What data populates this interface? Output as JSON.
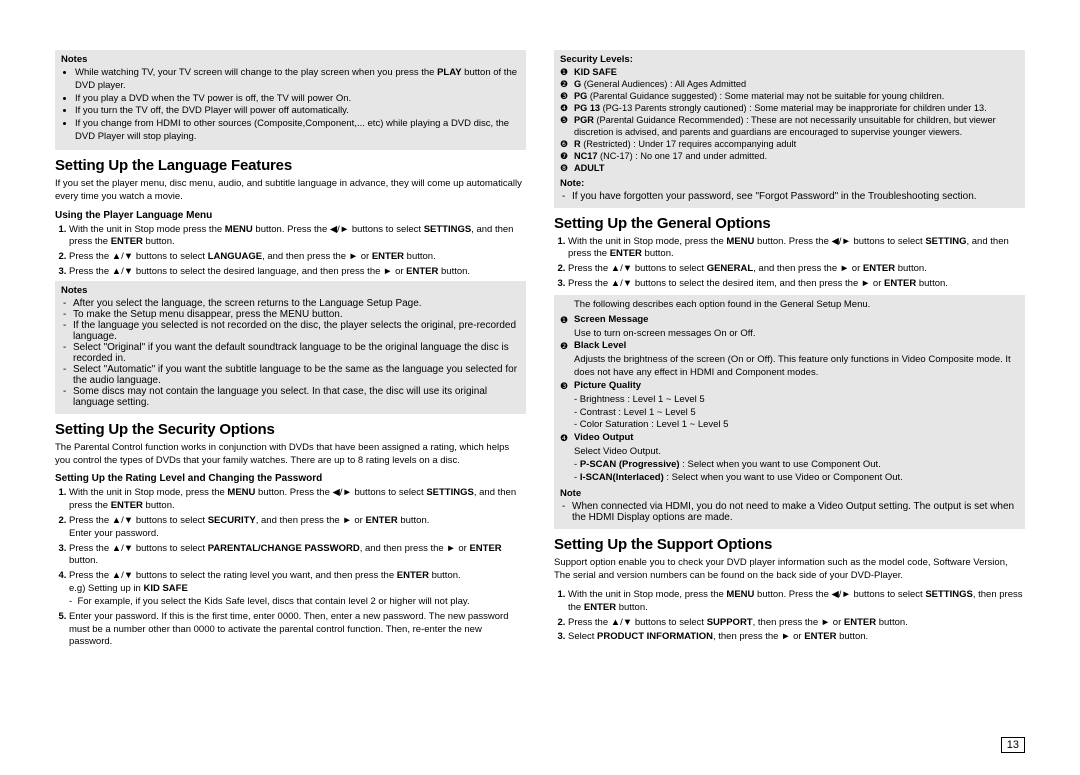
{
  "left": {
    "notes1": {
      "title": "Notes",
      "items": [
        "While watching TV, your TV screen will change to the play screen when you press the <b>PLAY</b> button of the DVD player.",
        "If you play a DVD when the TV power is off, the TV will power On.",
        "If you turn the TV off, the DVD Player will power off automatically.",
        "If you change from HDMI to other sources (Composite,Component,... etc) while playing a DVD disc, the DVD Player will stop playing."
      ]
    },
    "lang": {
      "heading": "Setting Up the Language Features",
      "lead": "If you set the player menu, disc menu, audio, and subtitle language in advance, they will come up automatically every time you watch a movie.",
      "sub1": "Using the Player Language Menu",
      "steps": [
        "With the unit in Stop mode press the <b>MENU</b> button. Press the ◀/► buttons to select <b>SETTINGS</b>, and then press the <b>ENTER</b> button.",
        "Press the ▲/▼ buttons to select <b>LANGUAGE</b>, and then press the ► or <b>ENTER</b> button.",
        "Press the ▲/▼ buttons to select the desired language, and then press the ► or <b>ENTER</b> button."
      ],
      "notes": {
        "title": "Notes",
        "items": [
          "After you select the language, the screen returns to the Language Setup Page.",
          "To make the Setup menu disappear, press the MENU button.",
          "If the language you selected is not recorded on the disc, the player selects the original, pre-recorded language.",
          "Select \"Original\" if you want the default soundtrack language to be the original language the disc is recorded in.",
          "Select \"Automatic\" if you want the subtitle language to be the same as the language you selected for the audio language.",
          "Some discs may not contain the language you select. In that case, the disc will use its original language setting."
        ]
      }
    },
    "sec": {
      "heading": "Setting Up the Security Options",
      "lead": "The Parental Control function works in conjunction with DVDs that have been assigned a rating, which helps you control the types of DVDs that your family watches. There are up to 8 rating levels on a disc.",
      "sub1": "Setting Up the Rating Level and Changing the Password",
      "steps": [
        "With the unit in Stop mode, press the <b>MENU</b> button. Press the ◀/► buttons to select <b>SETTINGS</b>, and then press the <b>ENTER</b> button.",
        "Press the ▲/▼ buttons to select <b>SECURITY</b>, and then press the ► or <b>ENTER</b> button.<br>Enter your password.",
        "Press the ▲/▼ buttons to select <b>PARENTAL/CHANGE PASSWORD</b>, and then press the ► or <b>ENTER</b> button.",
        "Press the ▲/▼ buttons to select the rating level you want, and then press the <b>ENTER</b> button.<br>e.g) Setting up in <b>KID SAFE</b><br>- &nbsp;For example, if you select the Kids Safe level, discs that contain level 2 or higher will not play.",
        "Enter your password. If this is the first time, enter 0000. Then, enter a new password. The new password must be a number other than 0000 to activate the parental control function. Then, re-enter the new password."
      ]
    }
  },
  "right": {
    "levels": {
      "title": "Security Levels:",
      "items": [
        {
          "n": "❶",
          "label": "KID SAFE",
          "bold": true,
          "desc": ""
        },
        {
          "n": "❷",
          "label": "G",
          "desc": " (General Audiences) : All Ages Admitted"
        },
        {
          "n": "❸",
          "label": "PG",
          "desc": " (Parental Guidance suggested) : Some material may not be suitable for young children."
        },
        {
          "n": "❹",
          "label": "PG 13",
          "desc": " (PG-13 Parents strongly cautioned) : Some material may be inapproriate for children under 13."
        },
        {
          "n": "❺",
          "label": "PGR",
          "desc": " (Parental Guidance Recommended) : These are not necessarily unsuitable for children, but viewer discretion is advised, and parents and guardians are encouraged to supervise younger viewers."
        },
        {
          "n": "❻",
          "label": "R",
          "desc": " (Restricted) : Under 17 requires accompanying adult"
        },
        {
          "n": "❼",
          "label": "NC17",
          "desc": " (NC-17) : No one 17 and under admitted."
        },
        {
          "n": "❽",
          "label": "ADULT",
          "bold": true,
          "desc": ""
        }
      ],
      "noteTitle": "Note:",
      "noteItems": [
        "If you have forgotten your password, see \"Forgot Password\" in the Troubleshooting section."
      ]
    },
    "gen": {
      "heading": "Setting Up the General Options",
      "steps": [
        "With the unit in Stop mode, press the <b>MENU</b> button. Press the ◀/► buttons to select <b>SETTING</b>, and then press the <b>ENTER</b> button.",
        "Press the ▲/▼ buttons to select <b>GENERAL</b>, and then press the ► or <b>ENTER</b> button.",
        "Press the ▲/▼ buttons to select the desired item, and then press the ► or <b>ENTER</b> button."
      ],
      "box": {
        "lead": "The following describes each option found in the General Setup Menu.",
        "items": [
          {
            "n": "❶",
            "t": "Screen Message",
            "d": [
              "Use to turn on-screen messages On or Off."
            ]
          },
          {
            "n": "❷",
            "t": "Black Level",
            "d": [
              "Adjusts the brightness of the screen (On or Off). This feature only functions in Video Composite mode. It does not have any effect in HDMI and Component modes."
            ]
          },
          {
            "n": "❸",
            "t": "Picture Quality",
            "d": [
              "- Brightness : Level 1 ~ Level 5",
              "- Contrast : Level 1 ~ Level 5",
              "- Color Saturation : Level 1 ~ Level 5"
            ]
          },
          {
            "n": "❹",
            "t": "Video Output",
            "d": [
              "Select Video Output.",
              "- <b>P-SCAN (Progressive)</b> : Select when you want to use Component Out.",
              "- <b>I-SCAN(Interlaced)</b> : Select when you want to use Video or Component Out."
            ]
          }
        ],
        "noteTitle": "Note",
        "noteItems": [
          "When connected via HDMI, you do not need to make a Video Output setting. The output is set when the HDMI Display options are made."
        ]
      }
    },
    "sup": {
      "heading": "Setting Up the Support Options",
      "lead": "Support option enable you to check your DVD player information such as the model code, Software Version, The serial and version numbers can be found on the back side of your DVD-Player.",
      "steps": [
        "With the unit in Stop mode, press the <b>MENU</b> button. Press the ◀/► buttons to select <b>SETTINGS</b>, then press the <b>ENTER</b> button.",
        "Press the ▲/▼ buttons to select <b>SUPPORT</b>, then press the ► or <b>ENTER</b> button.",
        "Select <b>PRODUCT INFORMATION</b>, then press the ► or <b>ENTER</b> button."
      ]
    }
  },
  "pagenum": "13"
}
